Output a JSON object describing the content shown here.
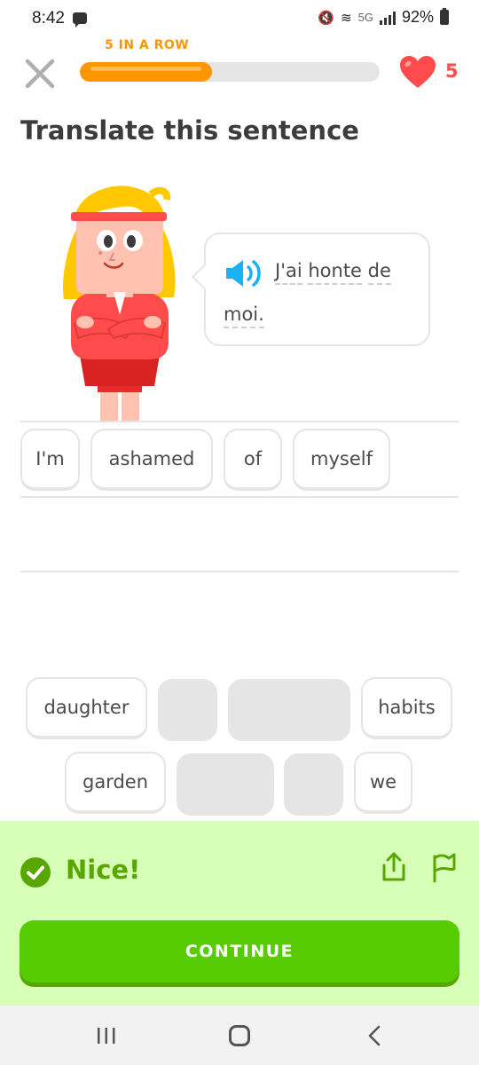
{
  "status_bar": {
    "time": "8:42",
    "network": "5G",
    "battery": "92%",
    "icons": [
      "message-icon",
      "mute-icon",
      "wifi-icon",
      "signal-icon",
      "battery-icon"
    ]
  },
  "header": {
    "close_icon": "close-icon",
    "streak_label": "5 IN A ROW",
    "progress_fraction": 0.44,
    "hearts": "5"
  },
  "title": "Translate this sentence",
  "prompt": {
    "speaker_icon": "speaker-icon",
    "words_line1": [
      "J'ai",
      "honte",
      "de"
    ],
    "words_line2": [
      "moi."
    ]
  },
  "answer_chips": [
    "I'm",
    "ashamed",
    "of",
    "myself"
  ],
  "word_bank": {
    "row1": [
      "daughter",
      "",
      "",
      "habits"
    ],
    "row2": [
      "garden",
      "",
      "",
      "we"
    ]
  },
  "feedback": {
    "text": "Nice!",
    "button": "CONTINUE",
    "icons": [
      "check-icon",
      "share-icon",
      "flag-icon"
    ]
  },
  "colors": {
    "accent_green": "#58cc02",
    "feedback_bg": "#d7ffb8",
    "feedback_text": "#58a700",
    "streak_orange": "#ff9600",
    "heart_red": "#ff4b4b",
    "speaker_blue": "#1cb0f6"
  }
}
